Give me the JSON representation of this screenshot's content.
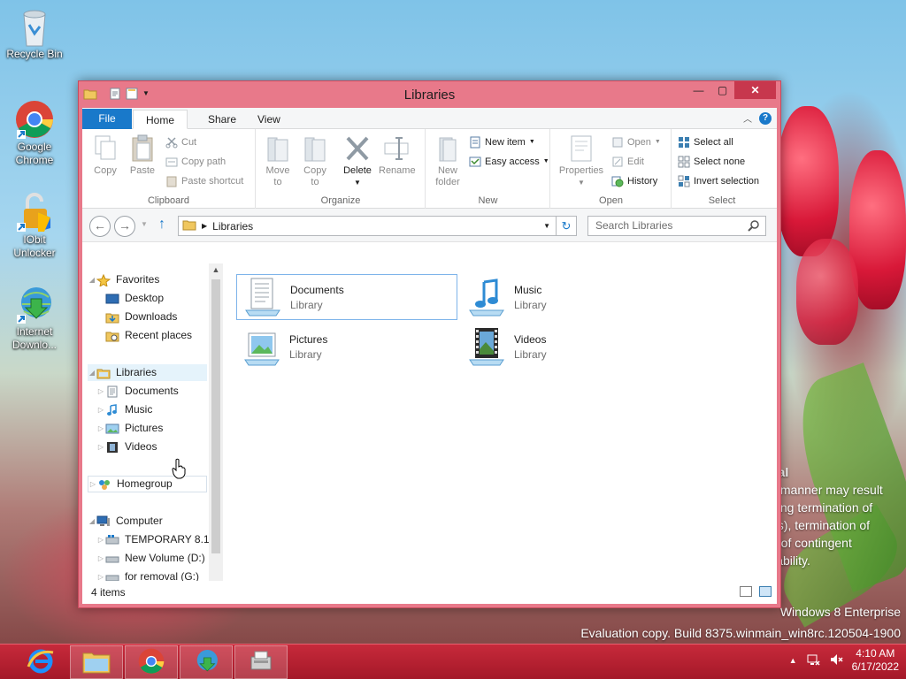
{
  "desktop": {
    "icons": [
      {
        "label": "Recycle Bin",
        "icon": "recycle-bin-icon"
      },
      {
        "label": "Google Chrome",
        "icon": "chrome-icon"
      },
      {
        "label": "IObit Unlocker",
        "icon": "unlocker-icon"
      },
      {
        "label": "Internet Downlo...",
        "icon": "idm-icon"
      }
    ],
    "legal_text": [
      "tial",
      "y manner may result",
      "ding termination of",
      "es), termination of",
      "e of contingent",
      " liability."
    ],
    "watermark": {
      "line1": "Windows 8 Enterprise",
      "line2": "Evaluation copy. Build 8375.winmain_win8rc.120504-1900"
    }
  },
  "window": {
    "title": "Libraries",
    "controls": {
      "minimize": "—",
      "maximize": "▢",
      "close": "✕"
    },
    "tabs": {
      "file": "File",
      "home": "Home",
      "share": "Share",
      "view": "View"
    },
    "ribbon": {
      "clipboard": {
        "label": "Clipboard",
        "copy": "Copy",
        "paste": "Paste",
        "cut": "Cut",
        "copy_path": "Copy path",
        "paste_shortcut": "Paste shortcut"
      },
      "organize": {
        "label": "Organize",
        "move_to": "Move",
        "move_to2": "to",
        "copy_to": "Copy",
        "copy_to2": "to",
        "delete": "Delete",
        "rename": "Rename"
      },
      "new": {
        "label": "New",
        "new_folder": "New",
        "new_folder2": "folder",
        "new_item": "New item",
        "easy_access": "Easy access"
      },
      "open": {
        "label": "Open",
        "properties": "Properties",
        "open": "Open",
        "edit": "Edit",
        "history": "History"
      },
      "select": {
        "label": "Select",
        "select_all": "Select all",
        "select_none": "Select none",
        "invert": "Invert selection"
      }
    },
    "address": {
      "path": "Libraries",
      "search_placeholder": "Search Libraries"
    },
    "nav": {
      "favorites": "Favorites",
      "desktop": "Desktop",
      "downloads": "Downloads",
      "recent": "Recent places",
      "libraries": "Libraries",
      "documents": "Documents",
      "music": "Music",
      "pictures": "Pictures",
      "videos": "Videos",
      "homegroup": "Homegroup",
      "computer": "Computer",
      "drive_c": "TEMPORARY 8.1",
      "drive_d": "New Volume (D:)",
      "drive_g": "for removal (G:)"
    },
    "libraries": [
      {
        "name": "Documents",
        "type": "Library"
      },
      {
        "name": "Music",
        "type": "Library"
      },
      {
        "name": "Pictures",
        "type": "Library"
      },
      {
        "name": "Videos",
        "type": "Library"
      }
    ],
    "status": "4 items"
  },
  "taskbar": {
    "clock_time": "4:10 AM",
    "clock_date": "6/17/2022"
  }
}
